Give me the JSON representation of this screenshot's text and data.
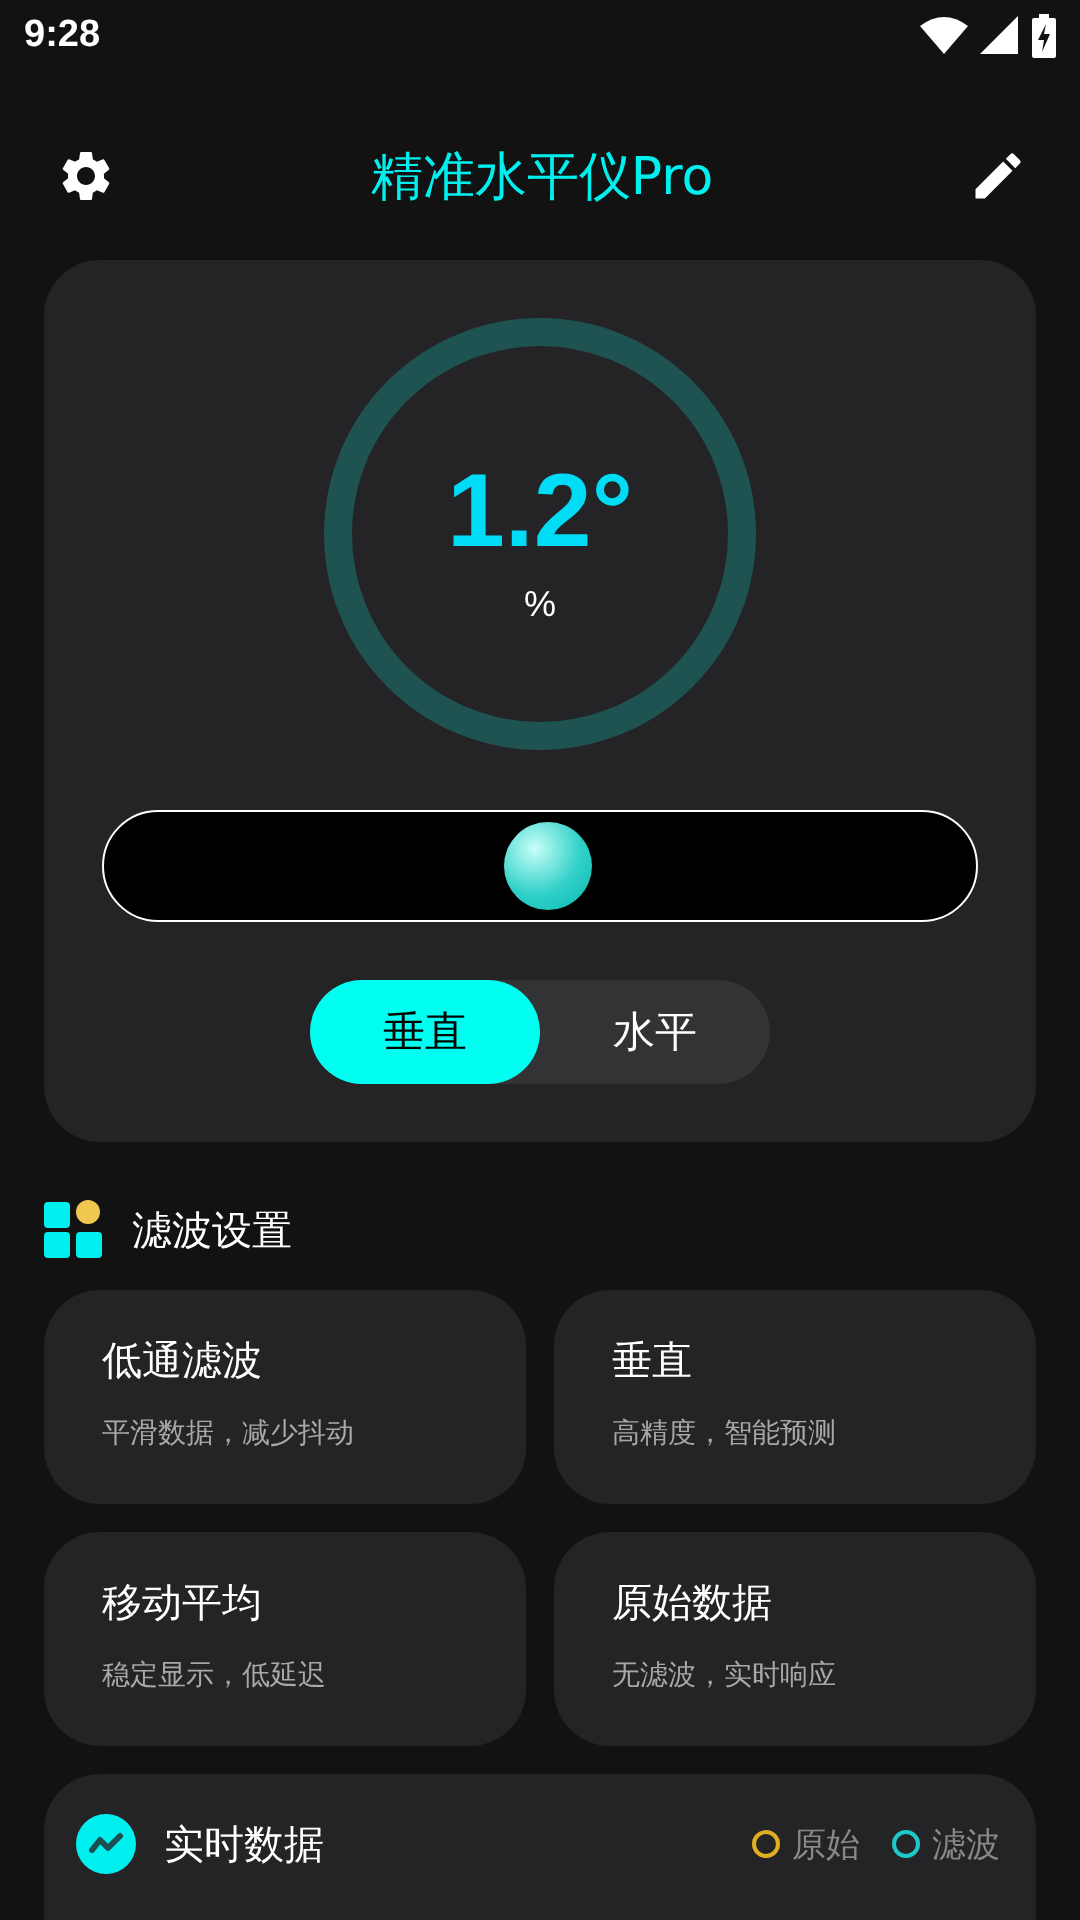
{
  "status_bar": {
    "time": "9:28"
  },
  "header": {
    "title": "精准水平仪Pro"
  },
  "gauge": {
    "angle": "1.2°",
    "unit": "%"
  },
  "bubble": {
    "level": 0.51
  },
  "mode_tabs": [
    {
      "label": "垂直",
      "selected": true
    },
    {
      "label": "水平",
      "selected": false
    }
  ],
  "filter_section": {
    "title": "滤波设置"
  },
  "filters": [
    {
      "title": "低通滤波",
      "subtitle": "平滑数据，减少抖动"
    },
    {
      "title": "垂直",
      "subtitle": "高精度，智能预测"
    },
    {
      "title": "移动平均",
      "subtitle": "稳定显示，低延迟"
    },
    {
      "title": "原始数据",
      "subtitle": "无滤波，实时响应"
    }
  ],
  "realtime": {
    "title": "实时数据",
    "legend": [
      {
        "label": "原始",
        "color": "#e0b020"
      },
      {
        "label": "滤波",
        "color": "#1ec8c8"
      }
    ]
  }
}
